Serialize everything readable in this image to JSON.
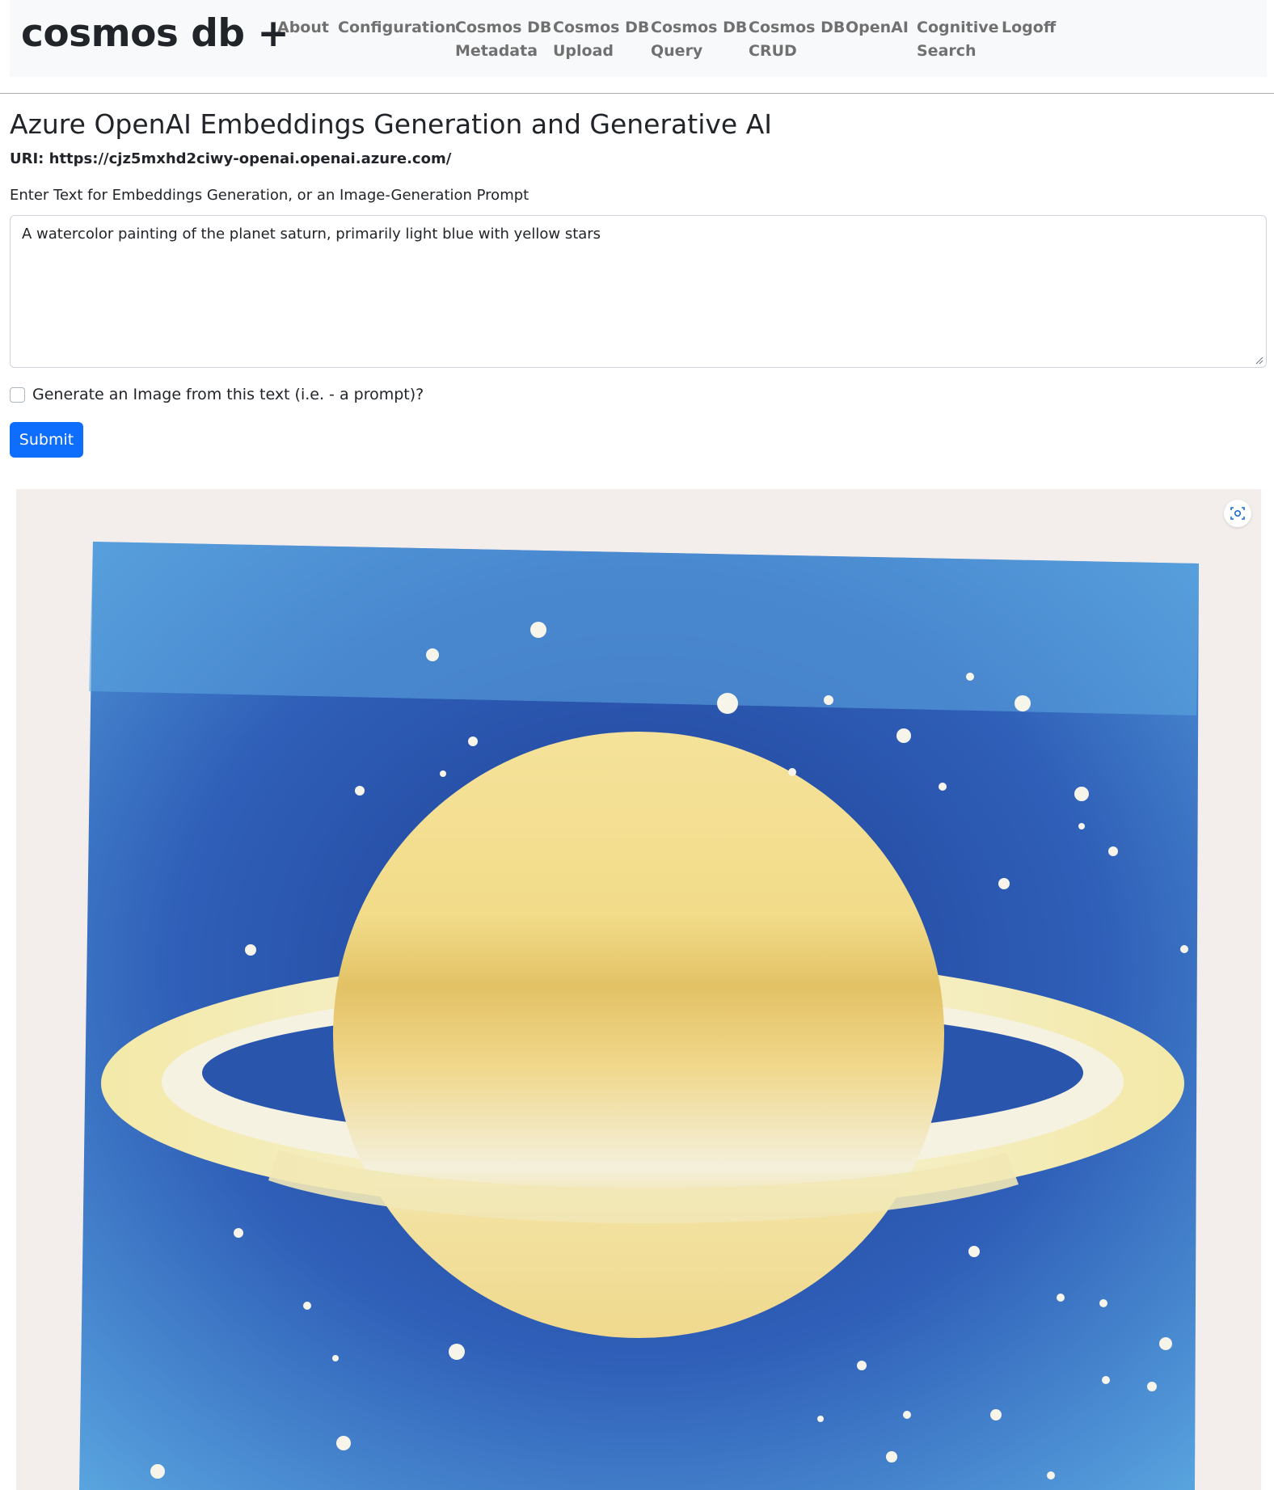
{
  "nav": {
    "brand": "cosmos db +",
    "items": [
      {
        "line1": "About",
        "line2": ""
      },
      {
        "line1": "Configuration",
        "line2": ""
      },
      {
        "line1": "Cosmos DB",
        "line2": "Metadata"
      },
      {
        "line1": "Cosmos DB",
        "line2": "Upload"
      },
      {
        "line1": "Cosmos DB",
        "line2": "Query"
      },
      {
        "line1": "Cosmos DB",
        "line2": "CRUD"
      },
      {
        "line1": "OpenAI",
        "line2": ""
      },
      {
        "line1": "Cognitive",
        "line2": "Search"
      },
      {
        "line1": "Logoff",
        "line2": ""
      }
    ]
  },
  "page": {
    "title": "Azure OpenAI Embeddings Generation and Generative AI",
    "uri": "URI: https://cjz5mxhd2ciwy-openai.openai.azure.com/"
  },
  "form": {
    "label": "Enter Text for Embeddings Generation, or an Image-Generation Prompt",
    "text_value": "A watercolor painting of the planet saturn, primarily light blue with yellow stars",
    "checkbox_label": "Generate an Image from this text (i.e. - a prompt)?",
    "checkbox_checked": false,
    "submit_label": "Submit"
  },
  "result_image": {
    "description_icon": "visual-search-icon"
  },
  "colors": {
    "primary": "#0d6efd",
    "navbar_bg": "#f8f9fa",
    "sky_blue": "#4a8fd4",
    "planet_yellow": "#f2d97a"
  }
}
